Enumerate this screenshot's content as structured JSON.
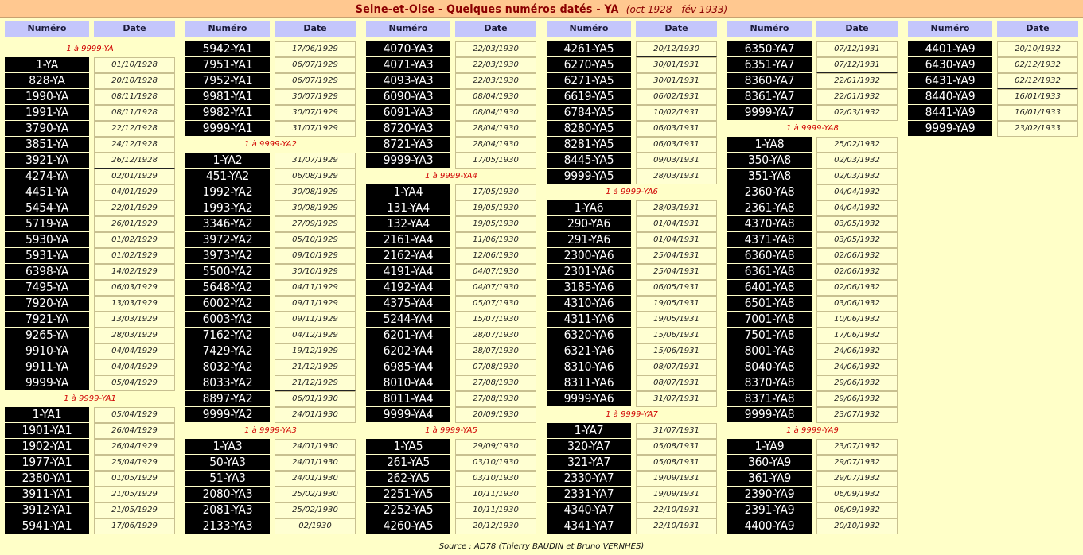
{
  "title": {
    "main": "Seine-et-Oise - Quelques numéros datés - YA",
    "sub": "(oct 1928 - fév 1933)"
  },
  "headers": {
    "numero": "Numéro",
    "date": "Date"
  },
  "footer": "Source : AD78 (Thierry BAUDIN et Bruno VERNHES)",
  "columns": [
    [
      {
        "s": "1 à 9999-YA"
      },
      {
        "p": "1-YA",
        "d": "01/10/1928"
      },
      {
        "p": "828-YA",
        "d": "20/10/1928"
      },
      {
        "p": "1990-YA",
        "d": "08/11/1928"
      },
      {
        "p": "1991-YA",
        "d": "08/11/1928"
      },
      {
        "p": "3790-YA",
        "d": "22/12/1928"
      },
      {
        "p": "3851-YA",
        "d": "24/12/1928"
      },
      {
        "p": "3921-YA",
        "d": "26/12/1928",
        "u": true
      },
      {
        "p": "4274-YA",
        "d": "02/01/1929"
      },
      {
        "p": "4451-YA",
        "d": "04/01/1929"
      },
      {
        "p": "5454-YA",
        "d": "22/01/1929"
      },
      {
        "p": "5719-YA",
        "d": "26/01/1929"
      },
      {
        "p": "5930-YA",
        "d": "01/02/1929"
      },
      {
        "p": "5931-YA",
        "d": "01/02/1929"
      },
      {
        "p": "6398-YA",
        "d": "14/02/1929"
      },
      {
        "p": "7495-YA",
        "d": "06/03/1929"
      },
      {
        "p": "7920-YA",
        "d": "13/03/1929"
      },
      {
        "p": "7921-YA",
        "d": "13/03/1929"
      },
      {
        "p": "9265-YA",
        "d": "28/03/1929"
      },
      {
        "p": "9910-YA",
        "d": "04/04/1929"
      },
      {
        "p": "9911-YA",
        "d": "04/04/1929"
      },
      {
        "p": "9999-YA",
        "d": "05/04/1929"
      },
      {
        "s": "1 à 9999-YA1"
      },
      {
        "p": "1-YA1",
        "d": "05/04/1929"
      },
      {
        "p": "1901-YA1",
        "d": "26/04/1929"
      },
      {
        "p": "1902-YA1",
        "d": "26/04/1929"
      },
      {
        "p": "1977-YA1",
        "d": "25/04/1929"
      },
      {
        "p": "2380-YA1",
        "d": "01/05/1929"
      },
      {
        "p": "3911-YA1",
        "d": "21/05/1929"
      },
      {
        "p": "3912-YA1",
        "d": "21/05/1929"
      },
      {
        "p": "5941-YA1",
        "d": "17/06/1929"
      }
    ],
    [
      {
        "p": "5942-YA1",
        "d": "17/06/1929"
      },
      {
        "p": "7951-YA1",
        "d": "06/07/1929"
      },
      {
        "p": "7952-YA1",
        "d": "06/07/1929"
      },
      {
        "p": "9981-YA1",
        "d": "30/07/1929"
      },
      {
        "p": "9982-YA1",
        "d": "30/07/1929"
      },
      {
        "p": "9999-YA1",
        "d": "31/07/1929"
      },
      {
        "s": "1 à 9999-YA2"
      },
      {
        "p": "1-YA2",
        "d": "31/07/1929"
      },
      {
        "p": "451-YA2",
        "d": "06/08/1929"
      },
      {
        "p": "1992-YA2",
        "d": "30/08/1929"
      },
      {
        "p": "1993-YA2",
        "d": "30/08/1929"
      },
      {
        "p": "3346-YA2",
        "d": "27/09/1929"
      },
      {
        "p": "3972-YA2",
        "d": "05/10/1929"
      },
      {
        "p": "3973-YA2",
        "d": "09/10/1929"
      },
      {
        "p": "5500-YA2",
        "d": "30/10/1929"
      },
      {
        "p": "5648-YA2",
        "d": "04/11/1929"
      },
      {
        "p": "6002-YA2",
        "d": "09/11/1929"
      },
      {
        "p": "6003-YA2",
        "d": "09/11/1929"
      },
      {
        "p": "7162-YA2",
        "d": "04/12/1929"
      },
      {
        "p": "7429-YA2",
        "d": "19/12/1929"
      },
      {
        "p": "8032-YA2",
        "d": "21/12/1929"
      },
      {
        "p": "8033-YA2",
        "d": "21/12/1929",
        "u": true
      },
      {
        "p": "8897-YA2",
        "d": "06/01/1930"
      },
      {
        "p": "9999-YA2",
        "d": "24/01/1930"
      },
      {
        "s": "1 à 9999-YA3"
      },
      {
        "p": "1-YA3",
        "d": "24/01/1930"
      },
      {
        "p": "50-YA3",
        "d": "24/01/1930"
      },
      {
        "p": "51-YA3",
        "d": "24/01/1930"
      },
      {
        "p": "2080-YA3",
        "d": "25/02/1930"
      },
      {
        "p": "2081-YA3",
        "d": "25/02/1930"
      },
      {
        "p": "2133-YA3",
        "d": "02/1930"
      }
    ],
    [
      {
        "p": "4070-YA3",
        "d": "22/03/1930"
      },
      {
        "p": "4071-YA3",
        "d": "22/03/1930"
      },
      {
        "p": "4093-YA3",
        "d": "22/03/1930"
      },
      {
        "p": "6090-YA3",
        "d": "08/04/1930"
      },
      {
        "p": "6091-YA3",
        "d": "08/04/1930"
      },
      {
        "p": "8720-YA3",
        "d": "28/04/1930"
      },
      {
        "p": "8721-YA3",
        "d": "28/04/1930"
      },
      {
        "p": "9999-YA3",
        "d": "17/05/1930"
      },
      {
        "s": "1 à 9999-YA4"
      },
      {
        "p": "1-YA4",
        "d": "17/05/1930"
      },
      {
        "p": "131-YA4",
        "d": "19/05/1930"
      },
      {
        "p": "132-YA4",
        "d": "19/05/1930"
      },
      {
        "p": "2161-YA4",
        "d": "11/06/1930"
      },
      {
        "p": "2162-YA4",
        "d": "12/06/1930"
      },
      {
        "p": "4191-YA4",
        "d": "04/07/1930"
      },
      {
        "p": "4192-YA4",
        "d": "04/07/1930"
      },
      {
        "p": "4375-YA4",
        "d": "05/07/1930"
      },
      {
        "p": "5244-YA4",
        "d": "15/07/1930"
      },
      {
        "p": "6201-YA4",
        "d": "28/07/1930"
      },
      {
        "p": "6202-YA4",
        "d": "28/07/1930"
      },
      {
        "p": "6985-YA4",
        "d": "07/08/1930"
      },
      {
        "p": "8010-YA4",
        "d": "27/08/1930"
      },
      {
        "p": "8011-YA4",
        "d": "27/08/1930"
      },
      {
        "p": "9999-YA4",
        "d": "20/09/1930"
      },
      {
        "s": "1 à 9999-YA5"
      },
      {
        "p": "1-YA5",
        "d": "29/09/1930"
      },
      {
        "p": "261-YA5",
        "d": "03/10/1930"
      },
      {
        "p": "262-YA5",
        "d": "03/10/1930"
      },
      {
        "p": "2251-YA5",
        "d": "10/11/1930"
      },
      {
        "p": "2252-YA5",
        "d": "10/11/1930"
      },
      {
        "p": "4260-YA5",
        "d": "20/12/1930"
      }
    ],
    [
      {
        "p": "4261-YA5",
        "d": "20/12/1930",
        "u": true
      },
      {
        "p": "6270-YA5",
        "d": "30/01/1931"
      },
      {
        "p": "6271-YA5",
        "d": "30/01/1931"
      },
      {
        "p": "6619-YA5",
        "d": "06/02/1931"
      },
      {
        "p": "6784-YA5",
        "d": "10/02/1931"
      },
      {
        "p": "8280-YA5",
        "d": "06/03/1931"
      },
      {
        "p": "8281-YA5",
        "d": "06/03/1931"
      },
      {
        "p": "8445-YA5",
        "d": "09/03/1931"
      },
      {
        "p": "9999-YA5",
        "d": "28/03/1931"
      },
      {
        "s": "1 à 9999-YA6"
      },
      {
        "p": "1-YA6",
        "d": "28/03/1931"
      },
      {
        "p": "290-YA6",
        "d": "01/04/1931"
      },
      {
        "p": "291-YA6",
        "d": "01/04/1931"
      },
      {
        "p": "2300-YA6",
        "d": "25/04/1931"
      },
      {
        "p": "2301-YA6",
        "d": "25/04/1931"
      },
      {
        "p": "3185-YA6",
        "d": "06/05/1931"
      },
      {
        "p": "4310-YA6",
        "d": "19/05/1931"
      },
      {
        "p": "4311-YA6",
        "d": "19/05/1931"
      },
      {
        "p": "6320-YA6",
        "d": "15/06/1931"
      },
      {
        "p": "6321-YA6",
        "d": "15/06/1931"
      },
      {
        "p": "8310-YA6",
        "d": "08/07/1931"
      },
      {
        "p": "8311-YA6",
        "d": "08/07/1931"
      },
      {
        "p": "9999-YA6",
        "d": "31/07/1931"
      },
      {
        "s": "1 à 9999-YA7"
      },
      {
        "p": "1-YA7",
        "d": "31/07/1931"
      },
      {
        "p": "320-YA7",
        "d": "05/08/1931"
      },
      {
        "p": "321-YA7",
        "d": "05/08/1931"
      },
      {
        "p": "2330-YA7",
        "d": "19/09/1931"
      },
      {
        "p": "2331-YA7",
        "d": "19/09/1931"
      },
      {
        "p": "4340-YA7",
        "d": "22/10/1931"
      },
      {
        "p": "4341-YA7",
        "d": "22/10/1931"
      }
    ],
    [
      {
        "p": "6350-YA7",
        "d": "07/12/1931"
      },
      {
        "p": "6351-YA7",
        "d": "07/12/1931",
        "u": true
      },
      {
        "p": "8360-YA7",
        "d": "22/01/1932"
      },
      {
        "p": "8361-YA7",
        "d": "22/01/1932"
      },
      {
        "p": "9999-YA7",
        "d": "02/03/1932"
      },
      {
        "s": "1 à 9999-YA8"
      },
      {
        "p": "1-YA8",
        "d": "25/02/1932"
      },
      {
        "p": "350-YA8",
        "d": "02/03/1932"
      },
      {
        "p": "351-YA8",
        "d": "02/03/1932"
      },
      {
        "p": "2360-YA8",
        "d": "04/04/1932"
      },
      {
        "p": "2361-YA8",
        "d": "04/04/1932"
      },
      {
        "p": "4370-YA8",
        "d": "03/05/1932"
      },
      {
        "p": "4371-YA8",
        "d": "03/05/1932"
      },
      {
        "p": "6360-YA8",
        "d": "02/06/1932"
      },
      {
        "p": "6361-YA8",
        "d": "02/06/1932"
      },
      {
        "p": "6401-YA8",
        "d": "02/06/1932"
      },
      {
        "p": "6501-YA8",
        "d": "03/06/1932"
      },
      {
        "p": "7001-YA8",
        "d": "10/06/1932"
      },
      {
        "p": "7501-YA8",
        "d": "17/06/1932"
      },
      {
        "p": "8001-YA8",
        "d": "24/06/1932"
      },
      {
        "p": "8040-YA8",
        "d": "24/06/1932"
      },
      {
        "p": "8370-YA8",
        "d": "29/06/1932"
      },
      {
        "p": "8371-YA8",
        "d": "29/06/1932"
      },
      {
        "p": "9999-YA8",
        "d": "23/07/1932"
      },
      {
        "s": "1 à 9999-YA9"
      },
      {
        "p": "1-YA9",
        "d": "23/07/1932"
      },
      {
        "p": "360-YA9",
        "d": "29/07/1932"
      },
      {
        "p": "361-YA9",
        "d": "29/07/1932"
      },
      {
        "p": "2390-YA9",
        "d": "06/09/1932"
      },
      {
        "p": "2391-YA9",
        "d": "06/09/1932"
      },
      {
        "p": "4400-YA9",
        "d": "20/10/1932"
      }
    ],
    [
      {
        "p": "4401-YA9",
        "d": "20/10/1932"
      },
      {
        "p": "6430-YA9",
        "d": "02/12/1932"
      },
      {
        "p": "6431-YA9",
        "d": "02/12/1932",
        "u": true
      },
      {
        "p": "8440-YA9",
        "d": "16/01/1933"
      },
      {
        "p": "8441-YA9",
        "d": "16/01/1933"
      },
      {
        "p": "9999-YA9",
        "d": "23/02/1933"
      }
    ]
  ]
}
